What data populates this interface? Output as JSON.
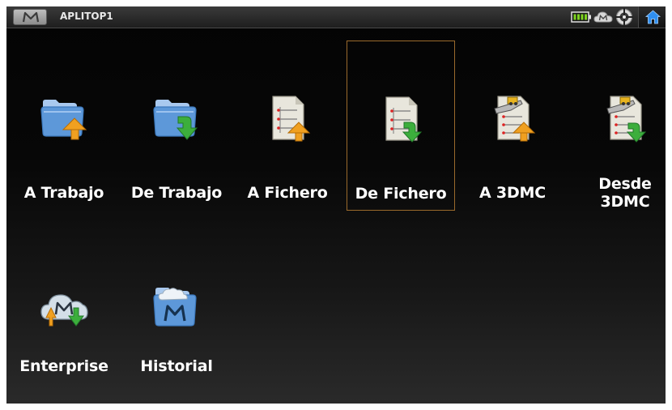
{
  "titlebar": {
    "menu_button_icon": "m-logo-icon",
    "app_title": "APLITOP1",
    "status_icons": [
      "battery-icon",
      "cloud-m-icon",
      "gps-crosshair-icon"
    ],
    "home_icon": "home-icon"
  },
  "colors": {
    "selected_border": "#9a6a2c",
    "folder_blue": "#6fa6de",
    "arrow_orange": "#f0a020",
    "arrow_green": "#3cae3c"
  },
  "tiles": [
    {
      "label": "A Trabajo",
      "icon": "folder-upload-icon",
      "selected": false
    },
    {
      "label": "De Trabajo",
      "icon": "folder-download-icon",
      "selected": false
    },
    {
      "label": "A Fichero",
      "icon": "file-upload-icon",
      "selected": false
    },
    {
      "label": "De Fichero",
      "icon": "file-download-icon",
      "selected": true
    },
    {
      "label": "A 3DMC",
      "icon": "3dmc-upload-icon",
      "selected": false
    },
    {
      "label": "Desde\n3DMC",
      "icon": "3dmc-download-icon",
      "selected": false
    },
    {
      "label": "Enterprise",
      "icon": "cloud-sync-icon",
      "selected": false
    },
    {
      "label": "Historial",
      "icon": "history-folder-icon",
      "selected": false
    }
  ]
}
